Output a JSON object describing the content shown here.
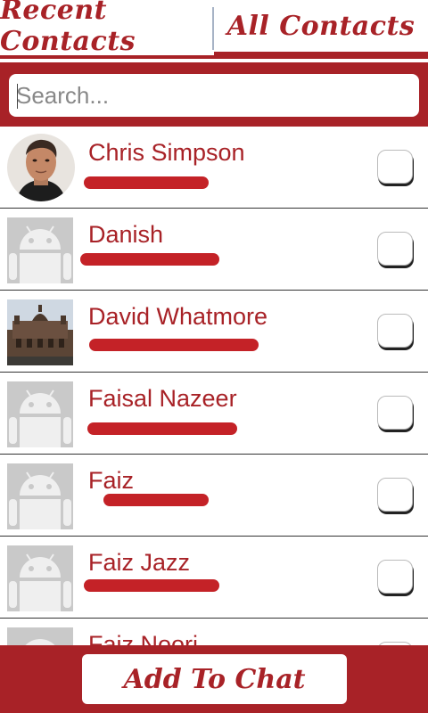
{
  "tabs": [
    {
      "label": "Recent Contacts"
    },
    {
      "label": "All Contacts"
    }
  ],
  "search": {
    "placeholder": "Search..."
  },
  "contacts": [
    {
      "name": "Chris Simpson",
      "phone_visible": "",
      "avatar": "photo-man",
      "checked": false
    },
    {
      "name": "Danish",
      "phone_visible": "",
      "avatar": "android-placeholder",
      "checked": false
    },
    {
      "name": "David Whatmore",
      "phone_visible": "",
      "avatar": "photo-building",
      "checked": false
    },
    {
      "name": "Faisal Nazeer",
      "phone_visible": "",
      "avatar": "android-placeholder",
      "checked": false
    },
    {
      "name": "Faiz",
      "phone_visible": "",
      "avatar": "android-placeholder",
      "checked": false
    },
    {
      "name": "Faiz Jazz",
      "phone_visible": "",
      "avatar": "android-placeholder",
      "checked": false
    },
    {
      "name": "Faiz Noori",
      "phone_visible": "",
      "avatar": "android-placeholder",
      "checked": false
    }
  ],
  "footer": {
    "add_button_label": "Add To Chat"
  },
  "colors": {
    "accent": "#a82227",
    "redaction": "#c42227"
  }
}
